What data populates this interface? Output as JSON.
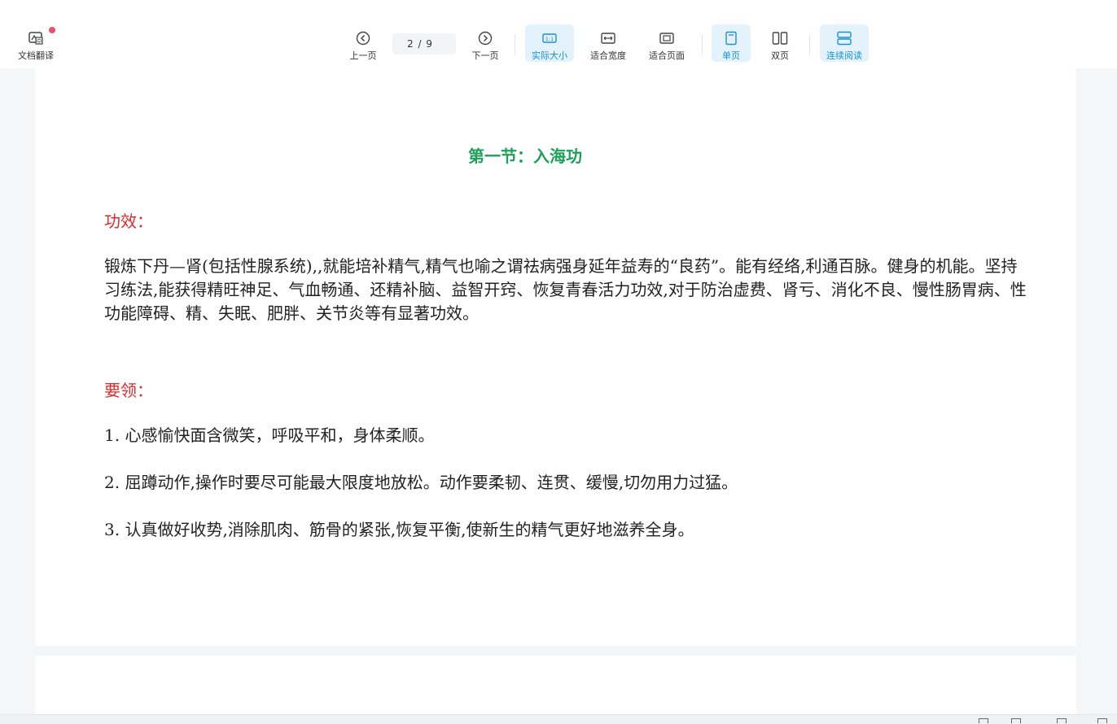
{
  "toolbar": {
    "translate_label": "文档翻译",
    "prev_label": "上一页",
    "page_indicator": "2 / 9",
    "next_label": "下一页",
    "actual_size_label": "实际大小",
    "fit_width_label": "适合宽度",
    "fit_page_label": "适合页面",
    "single_page_label": "单页",
    "double_page_label": "双页",
    "continuous_label": "连续阅读",
    "active_zoom": "实际大小",
    "active_layout": "单页",
    "active_scroll": "连续阅读",
    "accent_color": "#1a8fd6"
  },
  "document": {
    "section_title": "第一节：入海功",
    "effect_heading": "功效：",
    "effect_text": "锻炼下丹—肾(包括性腺系统),,就能培补精气,精气也喻之谓祛病强身延年益寿的“良药”。能有经络,利通百脉。健身的机能。坚持习练法,能获得精旺神足、气血畅通、还精补脑、益智开窍、恢复青春活力功效,对于防治虚费、肾亏、消化不良、慢性肠胃病、性功能障碍、精、失眠、肥胖、关节炎等有显著功效。",
    "essentials_heading": "要领：",
    "points": [
      "1. 心感愉快面含微笑，呼吸平和，身体柔顺。",
      "2. 屈蹲动作,操作时要尽可能最大限度地放松。动作要柔韧、连贯、缓慢,切勿用力过猛。",
      "3. 认真做好收势,消除肌肉、筋骨的紧张,恢复平衡,使新生的精气更好地滋养全身。"
    ],
    "title_color": "#1fa05a",
    "heading_color": "#e02a2a"
  }
}
